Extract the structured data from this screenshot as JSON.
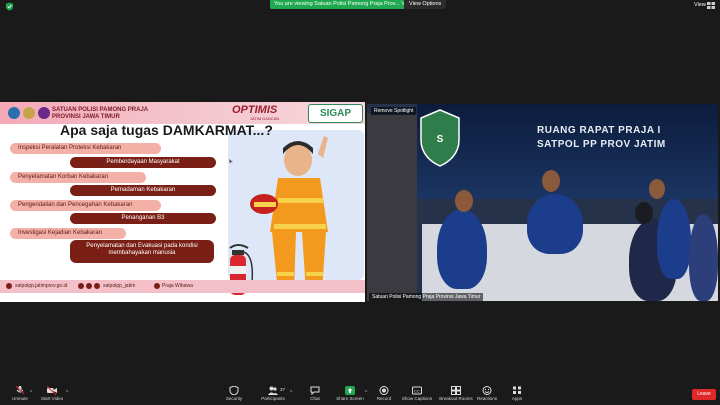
{
  "top_bar": {
    "viewing_text": "You are viewing Satuan Polisi Pamong Praja Prov... 's screen",
    "view_options": "View Options",
    "view_label": "View"
  },
  "slide": {
    "org_name_line1": "SATUAN POLISI PAMONG PRAJA",
    "org_name_line2": "PROVINSI JAWA TIMUR",
    "optimis": "OPTIMIS",
    "jatim_dancan": "JATIM DANCAN",
    "sigap": "SIGAP",
    "title": "Apa saja tugas DAMKARMAT...?",
    "tasks": [
      "Inspeksi Peralatan Proteksi Kebakaran",
      "Pemberdayaan Masyarakat",
      "Penyelamatan Korban Kebakaran",
      "Pemadaman Kebakaran",
      "Pengendalian dan Pencegahan Kebakaran",
      "Penanganan B3",
      "Investigasi Kejadian Kebakaran",
      "Penyelamatan dan Evakuasi pada kondisi membahayakan manusia"
    ],
    "footer": {
      "website": "satpolpp.jatimprov.go.id",
      "social": "satpolpp_jatim",
      "tagline": "Praja Wibawa"
    }
  },
  "video": {
    "remove_spotlight": "Remove Spotlight",
    "room_title_line1": "RUANG RAPAT PRAJA I",
    "room_title_line2": "SATPOL PP PROV JATIM",
    "participant_label": "Satuan Polisi Pamong Praja Provinsi Jawa Timur"
  },
  "toolbar": {
    "unmute": "Unmute",
    "start_video": "Start Video",
    "security": "Security",
    "participants": "Participants",
    "participants_count": "37",
    "chat": "Chat",
    "share_screen": "Share Screen",
    "record": "Record",
    "show_captions": "Show Captions",
    "breakout_rooms": "Breakout Rooms",
    "reactions": "Reactions",
    "apps": "Apps",
    "leave": "Leave"
  },
  "colors": {
    "share_green": "#1fa84f",
    "leave_red": "#e02828",
    "task_pink": "#f3b0a6",
    "task_maroon": "#7a1f15"
  }
}
